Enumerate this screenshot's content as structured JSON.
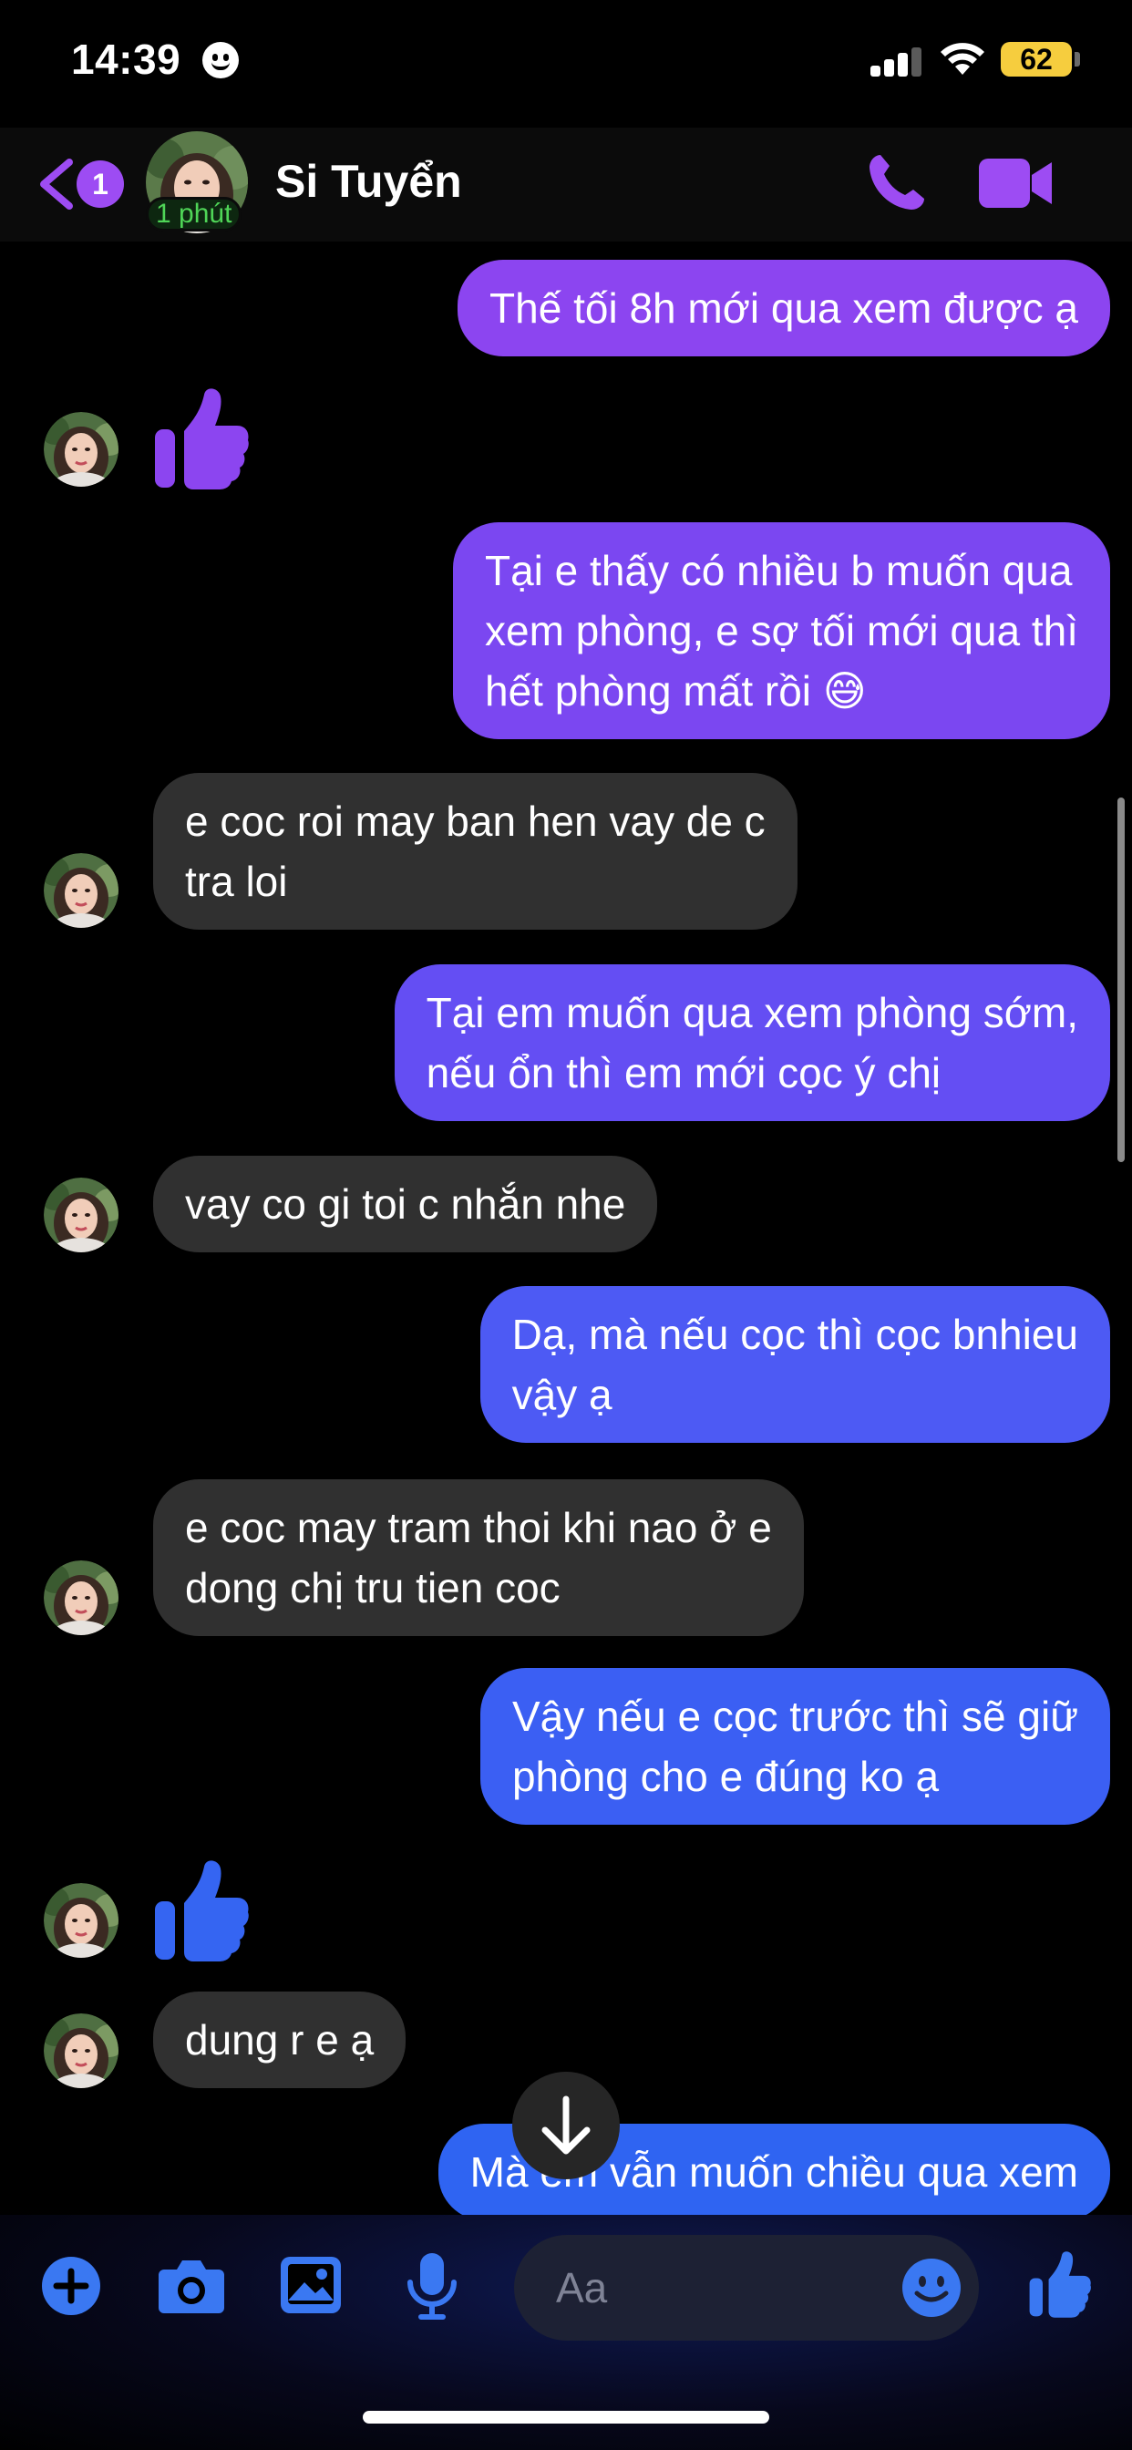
{
  "status_bar": {
    "time": "14:39",
    "battery": "62"
  },
  "header": {
    "back_badge": "1",
    "active_status": "1 phút",
    "contact_name": "Si Tuyển"
  },
  "messages": [
    {
      "from": "me",
      "text": "Thế tối 8h mới qua xem được ạ"
    },
    {
      "from": "them",
      "type": "like"
    },
    {
      "from": "me",
      "text": "Tại e thấy có nhiều b muốn qua\nxem phòng, e sợ tối mới qua thì\nhết phòng mất rồi 😅"
    },
    {
      "from": "them",
      "text": "e coc roi may ban hen vay de c\ntra loi"
    },
    {
      "from": "me",
      "text": "Tại em muốn qua xem phòng sớm,\nnếu ổn thì em mới cọc ý chị"
    },
    {
      "from": "them",
      "text": "vay co gi toi c nhắn nhe"
    },
    {
      "from": "me",
      "text": "Dạ, mà nếu cọc thì cọc bnhieu\nvậy ạ"
    },
    {
      "from": "them",
      "text": "e coc may tram thoi khi nao ở e\ndong chị tru tien coc"
    },
    {
      "from": "me",
      "text": "Vậy nếu e cọc trước thì sẽ giữ\nphòng cho e đúng ko ạ"
    },
    {
      "from": "them",
      "type": "like"
    },
    {
      "from": "them",
      "text": "dung r e ạ"
    },
    {
      "from": "me",
      "text": "Mà em vẫn muốn chiều qua xem"
    }
  ],
  "composer": {
    "placeholder": "Aa"
  },
  "colors": {
    "accent": "#9d4cf3",
    "bubble_top": "#8c45f0",
    "bubble_mid": "#5b52f5",
    "bubble_bottom": "#2f64f2",
    "incoming_bubble": "#303030",
    "composer_icon": "#3a78f2"
  },
  "icons": {
    "back": "chevron-left-icon",
    "call": "phone-icon",
    "video": "video-camera-icon",
    "like": "thumbs-up-icon",
    "scroll_down": "arrow-down-icon",
    "add": "plus-icon",
    "camera": "camera-icon",
    "gallery": "image-icon",
    "mic": "microphone-icon",
    "emoji": "smiley-icon",
    "send_like": "thumbs-up-icon"
  }
}
